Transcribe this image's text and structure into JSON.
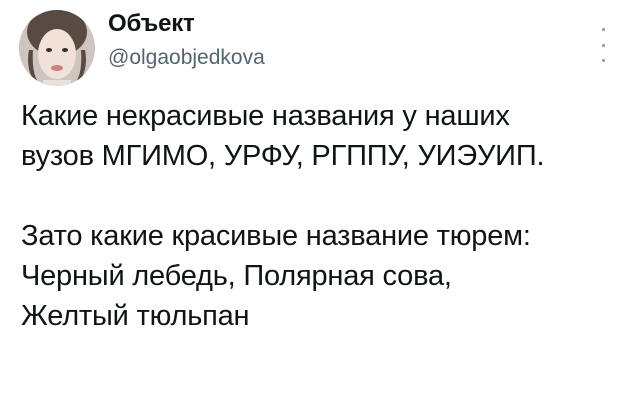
{
  "author": {
    "display_name": "Объект",
    "handle": "@olgaobjedkova"
  },
  "tweet": {
    "lines_p1": [
      "Какие некрасивые названия у наших",
      "вузов МГИМО, УРФУ, РГППУ, УИЭУИП."
    ],
    "lines_p2": [
      "Зато какие красивые название тюрем:",
      "Черный лебедь, Полярная сова,",
      "Желтый тюльпан"
    ]
  },
  "icons": {
    "more": "more-vertical-icon"
  }
}
